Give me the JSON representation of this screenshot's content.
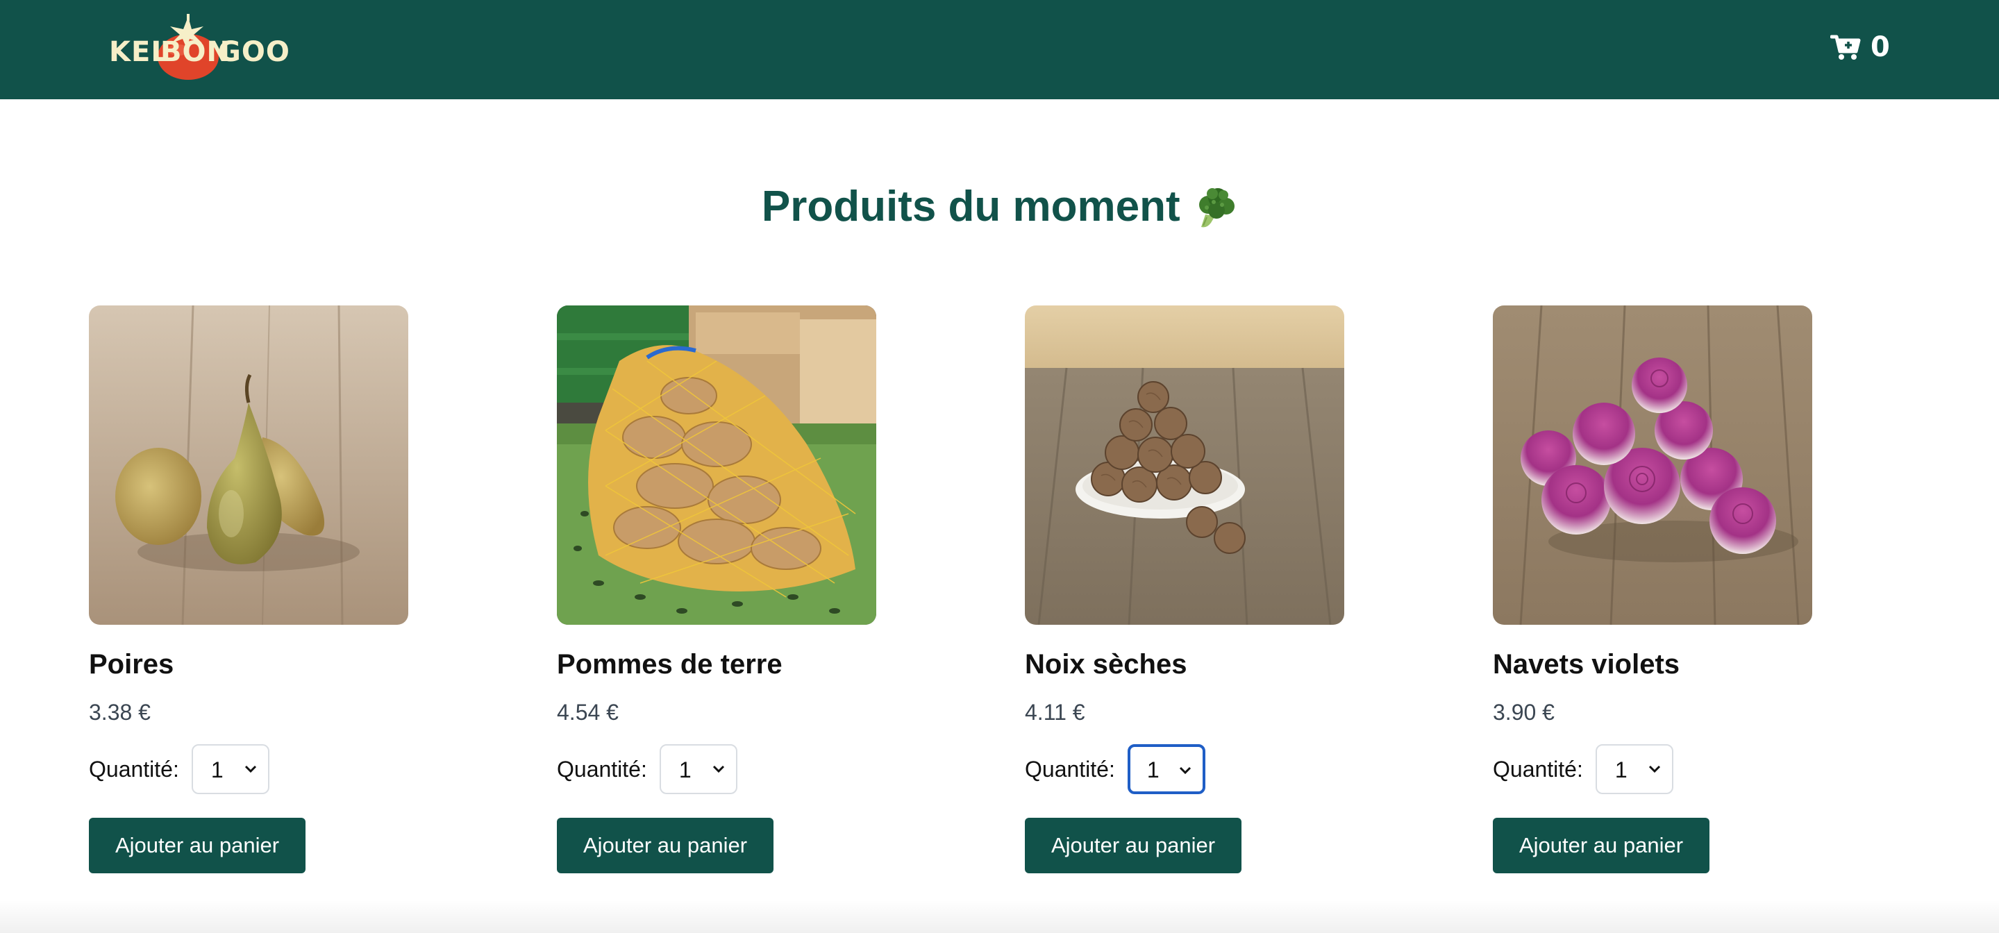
{
  "header": {
    "logo": {
      "part1": "KEL",
      "part2": "BON",
      "part3": "GOO",
      "icon": "tomato-logo-icon"
    },
    "cart": {
      "icon": "cart-icon",
      "count": "0"
    }
  },
  "main": {
    "title": "Produits du moment",
    "title_icon": "broccoli-icon",
    "products": [
      {
        "name": "Poires",
        "price": "3.38 €",
        "quantity_label": "Quantité:",
        "quantity": "1",
        "button": "Ajouter au panier",
        "image": "pears-image"
      },
      {
        "name": "Pommes de terre",
        "price": "4.54 €",
        "quantity_label": "Quantité:",
        "quantity": "1",
        "button": "Ajouter au panier",
        "image": "potatoes-image"
      },
      {
        "name": "Noix sèches",
        "price": "4.11 €",
        "quantity_label": "Quantité:",
        "quantity": "1",
        "button": "Ajouter au panier",
        "image": "walnuts-image"
      },
      {
        "name": "Navets violets",
        "price": "3.90 €",
        "quantity_label": "Quantité:",
        "quantity": "1",
        "button": "Ajouter au panier",
        "image": "turnips-image"
      }
    ]
  },
  "colors": {
    "brand_green": "#11524a",
    "logo_cream": "#f6efc8",
    "logo_tomato": "#e0442a",
    "focus_blue": "#1f5ec6",
    "price_gray": "#3b4652"
  }
}
